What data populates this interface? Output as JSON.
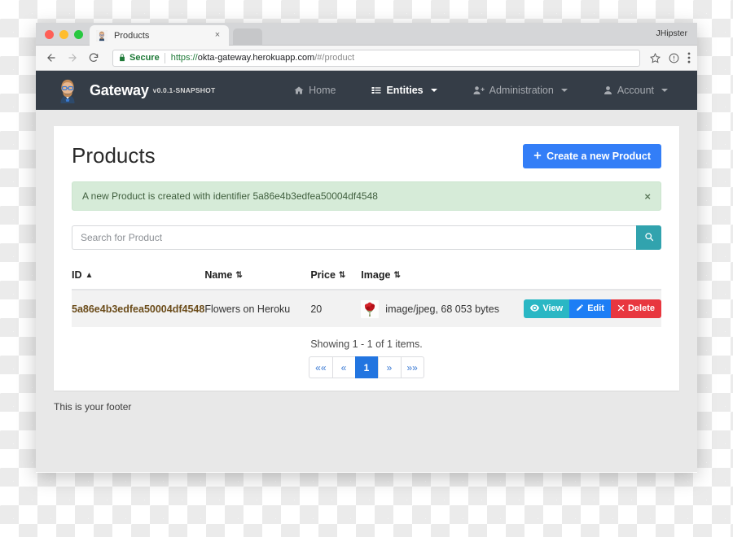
{
  "browser": {
    "tab": {
      "title": "Products",
      "favicon": "jhipster-avatar-icon",
      "close": "×"
    },
    "profile_name": "JHipster",
    "toolbar": {
      "back": "back-arrow-icon",
      "forward": "forward-arrow-icon",
      "reload": "reload-icon",
      "security_label": "Secure",
      "url": {
        "scheme": "https://",
        "host": "okta-gateway.herokuapp.com",
        "path": "/#/product"
      },
      "bookmark": "star-icon",
      "info": "info-circle-icon",
      "menu": "three-dots-menu-icon"
    }
  },
  "navbar": {
    "brand": "Gateway",
    "version": "v0.0.1-SNAPSHOT",
    "links": [
      {
        "label": "Home",
        "icon": "home-icon",
        "active": false,
        "caret": false
      },
      {
        "label": "Entities",
        "icon": "list-icon",
        "active": true,
        "caret": true
      },
      {
        "label": "Administration",
        "icon": "user-plus-icon",
        "active": false,
        "caret": true
      },
      {
        "label": "Account",
        "icon": "user-icon",
        "active": false,
        "caret": true
      }
    ]
  },
  "page": {
    "title": "Products",
    "create_button": "Create a new Product",
    "alert": {
      "message": "A new Product is created with identifier 5a86e4b3edfea50004df4548",
      "close": "×"
    },
    "search": {
      "placeholder": "Search for Product",
      "value": "",
      "button_icon": "search-icon"
    },
    "table": {
      "headers": [
        {
          "label": "ID",
          "sort": "▲"
        },
        {
          "label": "Name",
          "sort": "⇅"
        },
        {
          "label": "Price",
          "sort": "⇅"
        },
        {
          "label": "Image",
          "sort": "⇅"
        }
      ],
      "rows": [
        {
          "id": "5a86e4b3edfea50004df4548",
          "name": "Flowers on Heroku",
          "price": "20",
          "image_meta": "image/jpeg, 68 053 bytes",
          "image_thumb": "flower-bouquet-thumbnail",
          "actions": [
            {
              "label": "View",
              "icon": "eye-icon",
              "color": "#2ab7c4"
            },
            {
              "label": "Edit",
              "icon": "pencil-icon",
              "color": "#1d7ef5"
            },
            {
              "label": "Delete",
              "icon": "times-icon",
              "color": "#e8373f"
            }
          ]
        }
      ]
    },
    "pagination": {
      "showing": "Showing 1 - 1 of 1 items.",
      "items": [
        {
          "label": "««",
          "active": false
        },
        {
          "label": "«",
          "active": false
        },
        {
          "label": "1",
          "active": true
        },
        {
          "label": "»",
          "active": false
        },
        {
          "label": "»»",
          "active": false
        }
      ]
    },
    "footer": "This is your footer"
  },
  "colors": {
    "navbar_bg": "#353d47",
    "primary": "#337ef7",
    "success_bg": "#d6ebd8",
    "teal": "#31a3ae",
    "danger": "#e8373f"
  }
}
